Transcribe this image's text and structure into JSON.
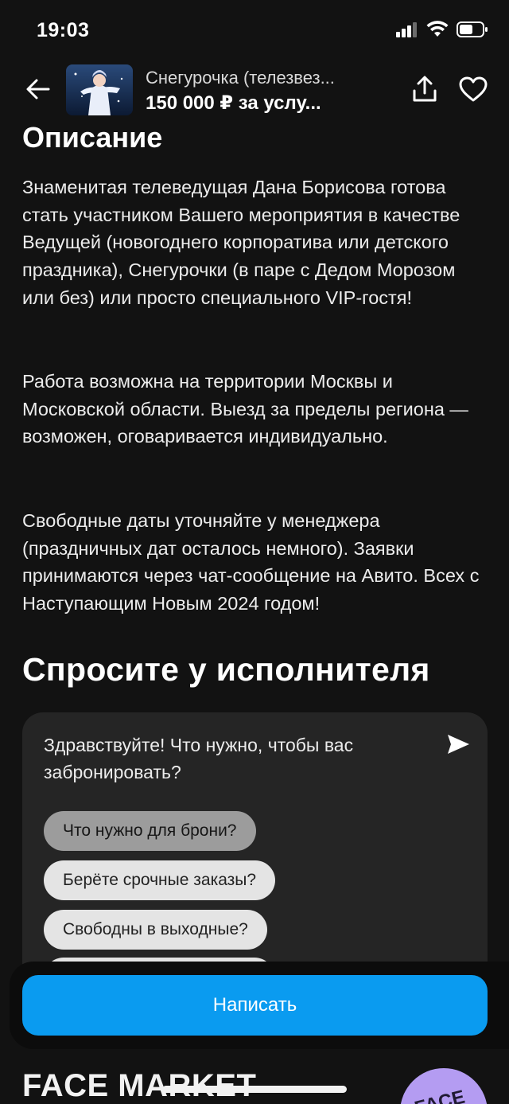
{
  "status_bar": {
    "time": "19:03",
    "icons": [
      "signal-icon",
      "wifi-icon",
      "battery-icon"
    ]
  },
  "header": {
    "title": "Снегурочка (телезвез...",
    "price": "150 000 ₽ за услу...",
    "icons": [
      "back-arrow-icon",
      "share-icon",
      "heart-icon"
    ]
  },
  "description": {
    "title": "Описание",
    "paragraphs": [
      "Знаменитая телеведущая Дана Борисова готова стать участником Вашего мероприятия в качестве Ведущей (новогоднего корпоратива или детского праздника), Снегурочки (в паре с Дедом Морозом или без) или просто специального VIP-гостя!",
      "Работа возможна на территории Москвы и Московской области. Выезд за пределы региона — возможен, оговаривается индивидуально.",
      "Свободные даты уточняйте у менеджера (праздничных дат осталось немного). Заявки принимаются через чат-сообщение на Авито. Всех с Наступающим Новым 2024 годом!"
    ]
  },
  "ask": {
    "title": "Спросите у исполнителя",
    "question": "Здравствуйте! Что нужно, чтобы вас забронировать?",
    "chips": [
      "Что нужно для брони?",
      "Берёте срочные заказы?",
      "Свободны в выходные?",
      ""
    ]
  },
  "cta": {
    "label": "Написать"
  },
  "brand": {
    "name": "FACE MARKET",
    "logo_text": "FACE"
  },
  "colors": {
    "background": "#121212",
    "card": "#252525",
    "accent": "#0a9bf0",
    "chip": "#e4e4e4",
    "chip_selected": "#9c9c9c"
  }
}
